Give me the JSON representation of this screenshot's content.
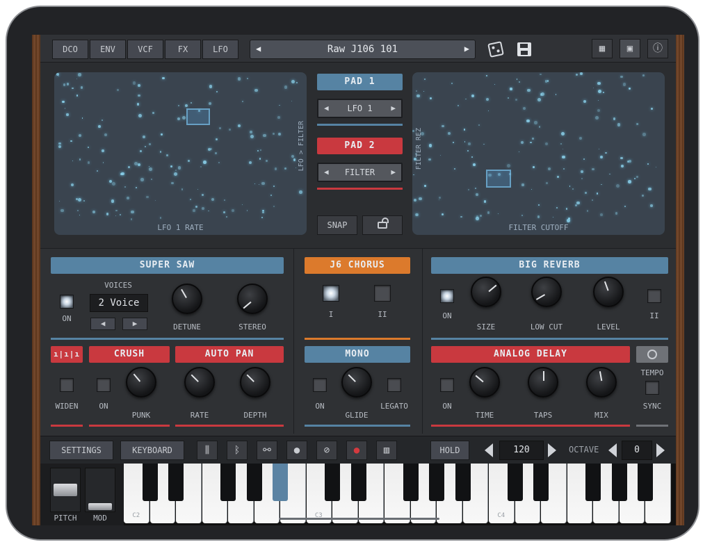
{
  "top_tabs": [
    "DCO",
    "ENV",
    "VCF",
    "FX",
    "LFO"
  ],
  "preset": {
    "name": "Raw J106 101",
    "prev": "◀",
    "next": "▶"
  },
  "pad_controls": {
    "pad1": "PAD 1",
    "pad1_target": "LFO 1",
    "pad2": "PAD 2",
    "pad2_target": "FILTER",
    "snap": "SNAP"
  },
  "pad1": {
    "xlabel": "LFO 1 RATE",
    "ylabel": "LFO > FILTER"
  },
  "pad2": {
    "xlabel": "FILTER CUTOFF",
    "ylabel": "FILTER REZ"
  },
  "supersaw": {
    "title": "SUPER SAW",
    "voices_label": "VOICES",
    "voices_value": "2 Voice",
    "on": "ON",
    "detune": "DETUNE",
    "stereo": "STEREO"
  },
  "chorus": {
    "title": "J6 CHORUS",
    "i": "I",
    "ii": "II"
  },
  "reverb": {
    "title": "BIG REVERB",
    "on": "ON",
    "size": "SIZE",
    "lowcut": "LOW CUT",
    "level": "LEVEL",
    "ii": "II"
  },
  "fx_row": {
    "crush": "CRUSH",
    "autopan": "AUTO PAN",
    "widen": "WIDEN",
    "on": "ON",
    "punk": "PUNK",
    "rate": "RATE",
    "depth": "DEPTH"
  },
  "mono": {
    "title": "MONO",
    "on": "ON",
    "glide": "GLIDE",
    "legato": "LEGATO"
  },
  "delay": {
    "title": "ANALOG DELAY",
    "on": "ON",
    "time": "TIME",
    "taps": "TAPS",
    "mix": "MIX",
    "tempo": "TEMPO",
    "sync": "SYNC"
  },
  "toolbar": {
    "settings": "SETTINGS",
    "keyboard": "KEYBOARD",
    "hold": "HOLD",
    "tempo_value": "120",
    "octave_label": "OCTAVE",
    "octave_value": "0"
  },
  "wheels": {
    "pitch": "PITCH",
    "mod": "MOD"
  },
  "keys": {
    "c2": "C2",
    "c3": "C3",
    "c4": "C4"
  },
  "colors": {
    "blue": "#5683a3",
    "red": "#c9393f",
    "orange": "#dc7a2c"
  }
}
